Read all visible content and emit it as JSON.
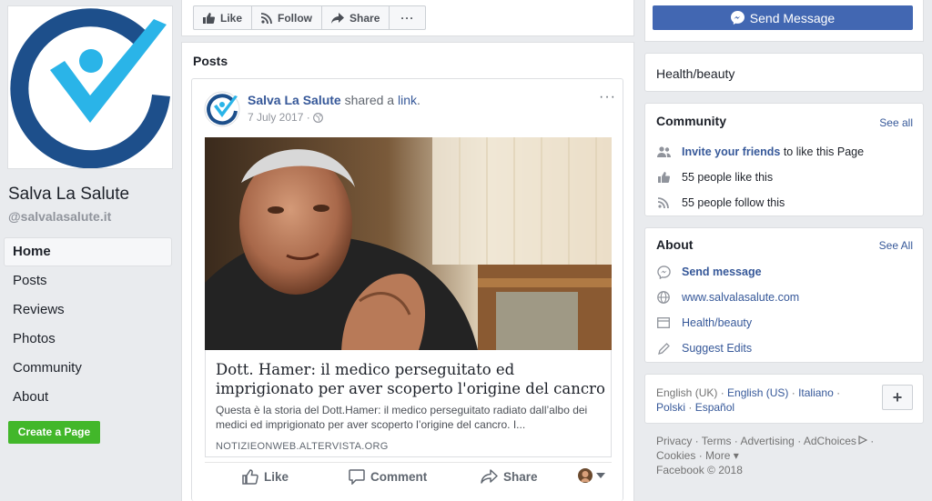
{
  "page": {
    "name": "Salva La Salute",
    "handle": "@salvalasalute.it"
  },
  "nav": {
    "items": [
      {
        "label": "Home"
      },
      {
        "label": "Posts"
      },
      {
        "label": "Reviews"
      },
      {
        "label": "Photos"
      },
      {
        "label": "Community"
      },
      {
        "label": "About"
      }
    ],
    "create_label": "Create a Page"
  },
  "toolbar": {
    "like_label": "Like",
    "follow_label": "Follow",
    "share_label": "Share",
    "more_label": "···",
    "send_label": "Send Message"
  },
  "posts": {
    "title": "Posts",
    "author": "Salva La Salute",
    "shared_text": " shared a ",
    "link_word": "link",
    "period": ".",
    "date": "7 July 2017",
    "meta_sep": " · ",
    "link_title": "Dott. Hamer: il medico perseguitato ed imprigionato per aver scoperto l'origine del cancro",
    "link_desc": "Questa è la storia del Dott.Hamer: il medico perseguitato radiato dall’albo dei medici ed imprigionato per aver scoperto l’origine del cancro. I...",
    "link_source": "NOTIZIEONWEB.ALTERVISTA.ORG",
    "like_label": "Like",
    "comment_label": "Comment",
    "share_label": "Share"
  },
  "category": {
    "label": "Health/beauty"
  },
  "community": {
    "title": "Community",
    "see_all": "See all",
    "invite_link": "Invite your friends",
    "invite_rest": " to like this Page",
    "likes": "55 people like this",
    "follows": "55 people follow this"
  },
  "about": {
    "title": "About",
    "see_all": "See All",
    "send_message": "Send message",
    "website": "www.salvalasalute.com",
    "category": "Health/beauty",
    "suggest": "Suggest Edits"
  },
  "languages": {
    "items": [
      "English (UK)",
      "English (US)",
      "Italiano",
      "Polski",
      "Español"
    ],
    "sep": " · ",
    "plus": "+"
  },
  "footer": {
    "privacy": "Privacy",
    "terms": "Terms",
    "advertising": "Advertising",
    "adchoices": "AdChoices",
    "cookies": "Cookies",
    "more": "More",
    "copyright": "Facebook © 2018",
    "sep": " · "
  },
  "colors": {
    "brand_blue": "#4267b2",
    "link_blue": "#365899",
    "green": "#42b72a",
    "logo_navy": "#1d4f8b",
    "logo_cyan": "#2ab4e8"
  }
}
